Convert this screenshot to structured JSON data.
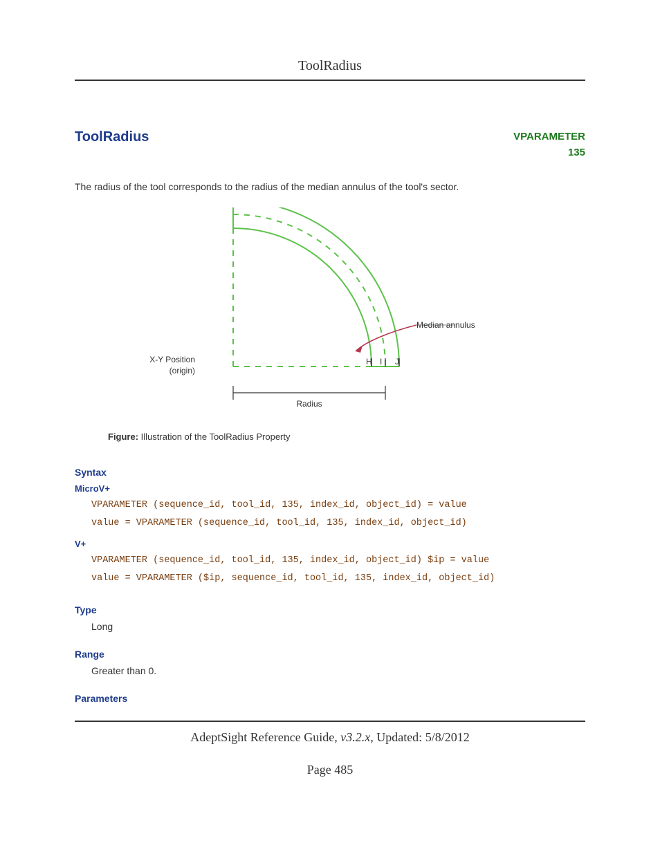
{
  "running_head": "ToolRadius",
  "title": "ToolRadius",
  "tag": {
    "name": "VPARAMETER",
    "number": "135"
  },
  "intro": "The radius of the tool corresponds to the radius of the median annulus of the tool's sector.",
  "figure": {
    "labels": {
      "median": "Median annulus",
      "origin_line1": "X-Y Position",
      "origin_line2": "(origin)",
      "H": "H",
      "I": "I",
      "J": "J",
      "radius": "Radius"
    },
    "caption_lead": "Figure:",
    "caption_text": " Illustration of the ToolRadius Property"
  },
  "sections": {
    "syntax": {
      "heading": "Syntax",
      "microv": {
        "heading": "MicroV+",
        "line1": "VPARAMETER (sequence_id, tool_id, 135, index_id, object_id) = value",
        "line2": "value = VPARAMETER (sequence_id, tool_id, 135, index_id, object_id)"
      },
      "vplus": {
        "heading": "V+",
        "line1": "VPARAMETER (sequence_id, tool_id, 135, index_id, object_id) $ip = value",
        "line2": "value = VPARAMETER ($ip, sequence_id, tool_id, 135, index_id, object_id)"
      }
    },
    "type": {
      "heading": "Type",
      "body": "Long"
    },
    "range": {
      "heading": "Range",
      "body": "Greater than 0."
    },
    "parameters": {
      "heading": "Parameters"
    }
  },
  "footer": {
    "guide": "AdeptSight Reference Guide",
    "version": ", v3.2.x",
    "updated_label": ", Updated: ",
    "updated_date": "5/8/2012",
    "page_label": "Page ",
    "page_number": "485"
  }
}
